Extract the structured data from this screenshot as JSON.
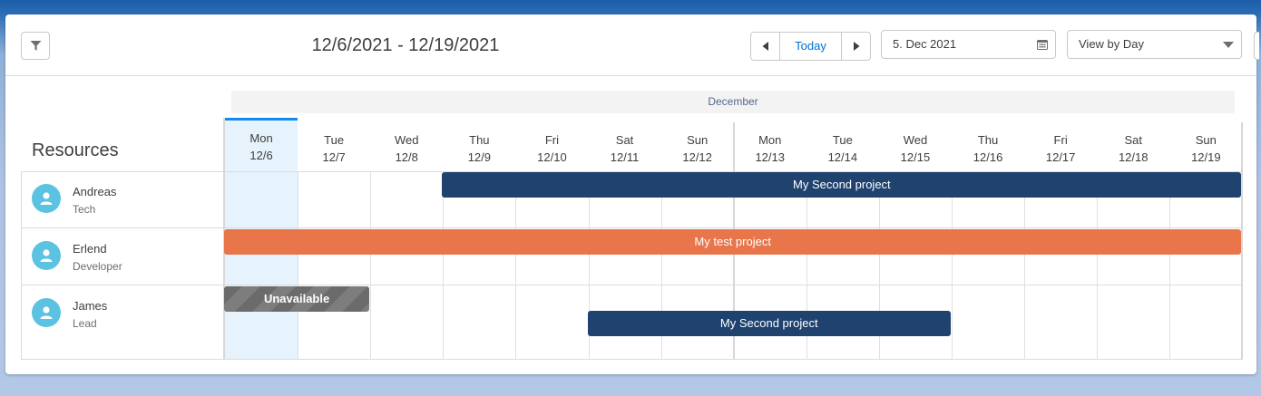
{
  "toolbar": {
    "range_title": "12/6/2021 - 12/19/2021",
    "today_label": "Today",
    "date_value": "5. Dec 2021",
    "view_value": "View by Day",
    "icons": {
      "filter": "filter-icon",
      "prev": "chevron-left-icon",
      "next": "chevron-right-icon",
      "calendar": "calendar-icon",
      "dropdown": "chevron-down-icon"
    }
  },
  "calendar": {
    "month": "December",
    "resources_title": "Resources",
    "today_index": 0,
    "days": [
      {
        "name": "Mon",
        "date": "12/6"
      },
      {
        "name": "Tue",
        "date": "12/7"
      },
      {
        "name": "Wed",
        "date": "12/8"
      },
      {
        "name": "Thu",
        "date": "12/9"
      },
      {
        "name": "Fri",
        "date": "12/10"
      },
      {
        "name": "Sat",
        "date": "12/11"
      },
      {
        "name": "Sun",
        "date": "12/12"
      },
      {
        "name": "Mon",
        "date": "12/13"
      },
      {
        "name": "Tue",
        "date": "12/14"
      },
      {
        "name": "Wed",
        "date": "12/15"
      },
      {
        "name": "Thu",
        "date": "12/16"
      },
      {
        "name": "Fri",
        "date": "12/17"
      },
      {
        "name": "Sat",
        "date": "12/18"
      },
      {
        "name": "Sun",
        "date": "12/19"
      }
    ],
    "resources": [
      {
        "name": "Andreas",
        "role": "Tech"
      },
      {
        "name": "Erlend",
        "role": "Developer"
      },
      {
        "name": "James",
        "role": "Lead"
      }
    ],
    "bars": [
      {
        "resource": 0,
        "label": "My Second project",
        "start": "12/9",
        "end": "12/19",
        "kind": "project"
      },
      {
        "resource": 1,
        "label": "My test project",
        "start": "12/6",
        "end": "12/19",
        "kind": "project"
      },
      {
        "resource": 2,
        "label": "Unavailable",
        "start": "12/6",
        "end": "12/7",
        "kind": "unavailable"
      },
      {
        "resource": 2,
        "label": "My Second project",
        "start": "12/11",
        "end": "12/15",
        "kind": "project"
      }
    ],
    "colors": {
      "navy_project": "#1f426e",
      "orange_project": "#e8764a",
      "unavailable": "#6b6b6b",
      "today_highlight": "#e6f2fc",
      "today_accent": "#1589ee",
      "avatar": "#5bc3e1"
    }
  }
}
